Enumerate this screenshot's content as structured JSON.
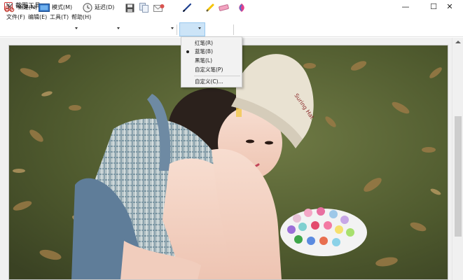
{
  "window": {
    "title": "截图工具",
    "minimize_glyph": "—",
    "maximize_glyph": "☐",
    "close_glyph": "✕"
  },
  "menu": {
    "items": [
      "文件(F)",
      "编辑(E)",
      "工具(T)",
      "帮助(H)"
    ]
  },
  "toolbar": {
    "new_label": "新建(N)",
    "mode_label": "模式(M)",
    "delay_label": "延迟(D)",
    "icons": {
      "new": "scissors-icon",
      "mode": "monitor-icon",
      "delay": "clock-icon",
      "save": "save-icon",
      "copy": "copy-icon",
      "send": "send-email-icon",
      "pen": "pen-icon",
      "highlighter": "highlighter-icon",
      "eraser": "eraser-icon",
      "paint3d": "paint-3d-icon"
    }
  },
  "pen_menu": {
    "items": [
      {
        "label": "红笔(R)",
        "selected": false
      },
      {
        "label": "蓝笔(B)",
        "selected": true
      },
      {
        "label": "黑笔(L)",
        "selected": false
      },
      {
        "label": "自定义笔(P)",
        "selected": false
      }
    ],
    "customize_label": "自定义(C)..."
  },
  "image": {
    "subject": "photo-of-girl-in-cap-with-palette",
    "hat_text": "Suring Hat"
  },
  "colors": {
    "accent_highlight": "#cce4f7",
    "menu_bg": "#f2f2f2"
  }
}
